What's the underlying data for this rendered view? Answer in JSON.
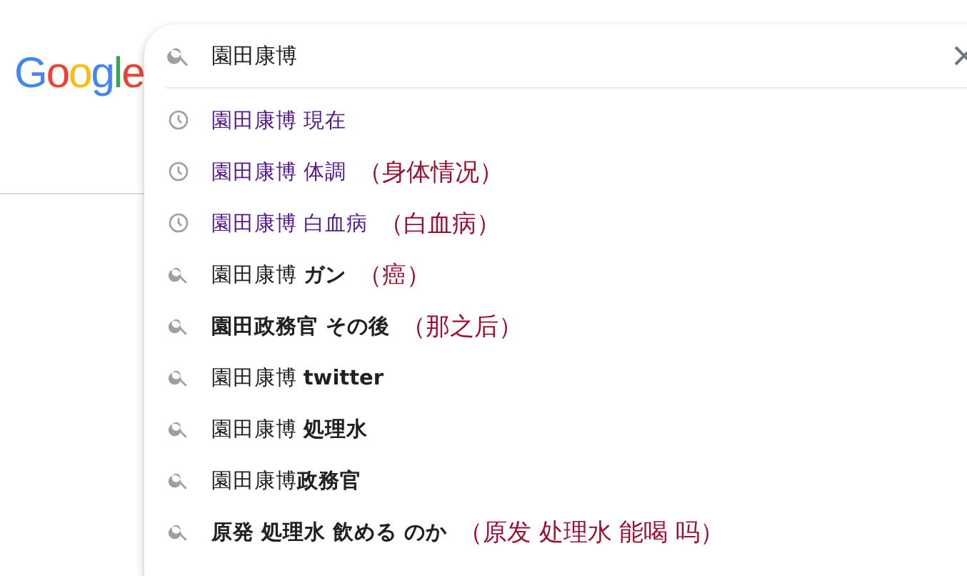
{
  "logo": "Google",
  "search": {
    "value": "園田康博"
  },
  "suggestions": [
    {
      "kind": "history",
      "text": "園田康博 現在"
    },
    {
      "kind": "history",
      "text": "園田康博 体調",
      "note": "（身体情况）"
    },
    {
      "kind": "history",
      "text": "園田康博 白血病",
      "note": "（白血病）"
    },
    {
      "kind": "search",
      "text": "園田康博 **ガン**",
      "note": "（癌）"
    },
    {
      "kind": "search",
      "text": "**園田政務官 その後**",
      "note": "（那之后）"
    },
    {
      "kind": "search",
      "text": "園田康博 **twitter**"
    },
    {
      "kind": "search",
      "text": "園田康博 **処理水**"
    },
    {
      "kind": "search",
      "text": "園田康博**政務官**"
    },
    {
      "kind": "search",
      "text": "**原発 処理水 飲める のか**",
      "note": "（原发 处理水 能喝 吗）"
    }
  ]
}
